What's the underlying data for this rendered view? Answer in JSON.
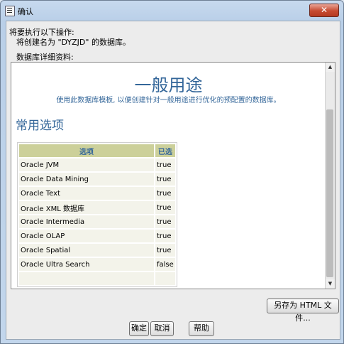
{
  "window": {
    "title": "确认",
    "close": "✕"
  },
  "message": {
    "line1": "将要执行以下操作:",
    "line2": "将创建名为 \"DYZJD\" 的数据库。",
    "details_label": "数据库详细资料:"
  },
  "doc": {
    "title": "一般用途",
    "subtitle": "使用此数据库模板, 以便创建针对一般用途进行优化的预配置的数据库。",
    "section": "常用选项",
    "table": {
      "headers": [
        "选项",
        "已选"
      ],
      "rows": [
        [
          "Oracle JVM",
          "true"
        ],
        [
          "Oracle Data Mining",
          "true"
        ],
        [
          "Oracle Text",
          "true"
        ],
        [
          "Oracle XML 数据库",
          "true"
        ],
        [
          "Oracle Intermedia",
          "true"
        ],
        [
          "Oracle OLAP",
          "true"
        ],
        [
          "Oracle Spatial",
          "true"
        ],
        [
          "Oracle Ultra Search",
          "false"
        ],
        [
          "",
          ""
        ]
      ]
    }
  },
  "buttons": {
    "save_html": "另存为 HTML 文件...",
    "ok": "确定",
    "cancel": "取消",
    "help": "帮助"
  }
}
